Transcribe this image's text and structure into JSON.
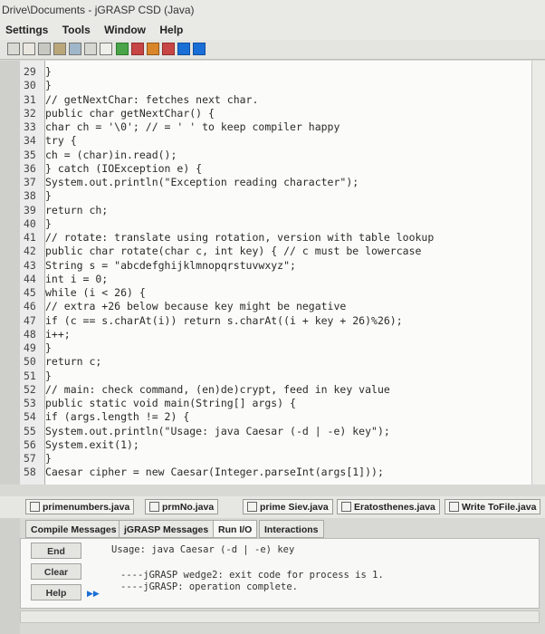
{
  "title": "Drive\\Documents - jGRASP CSD (Java)",
  "menu": [
    "Settings",
    "Tools",
    "Window",
    "Help"
  ],
  "code_lines": [
    {
      "num": "29",
      "text": "}"
    },
    {
      "num": "30",
      "text": "}"
    },
    {
      "num": "31",
      "text": "// getNextChar: fetches next char."
    },
    {
      "num": "32",
      "text": "public char getNextChar() {"
    },
    {
      "num": "33",
      "text": "char ch = '\\0'; // = ' ' to keep compiler happy"
    },
    {
      "num": "34",
      "text": "try {"
    },
    {
      "num": "35",
      "text": "ch = (char)in.read();"
    },
    {
      "num": "36",
      "text": "} catch (IOException e) {"
    },
    {
      "num": "37",
      "text": "System.out.println(\"Exception reading character\");"
    },
    {
      "num": "38",
      "text": "}"
    },
    {
      "num": "39",
      "text": "return ch;"
    },
    {
      "num": "40",
      "text": "}"
    },
    {
      "num": "41",
      "text": "// rotate: translate using rotation, version with table lookup"
    },
    {
      "num": "42",
      "text": "public char rotate(char c, int key) { // c must be lowercase"
    },
    {
      "num": "43",
      "text": "String s = \"abcdefghijklmnopqrstuvwxyz\";"
    },
    {
      "num": "44",
      "text": "int i = 0;"
    },
    {
      "num": "45",
      "text": "while (i < 26) {"
    },
    {
      "num": "46",
      "text": "// extra +26 below because key might be negative"
    },
    {
      "num": "47",
      "text": "if (c == s.charAt(i)) return s.charAt((i + key + 26)%26);"
    },
    {
      "num": "48",
      "text": "i++;"
    },
    {
      "num": "49",
      "text": "}"
    },
    {
      "num": "50",
      "text": "return c;"
    },
    {
      "num": "51",
      "text": "}"
    },
    {
      "num": "52",
      "text": "// main: check command, (en)de)crypt, feed in key value"
    },
    {
      "num": "53",
      "text": "public static void main(String[] args) {"
    },
    {
      "num": "54",
      "text": "if (args.length != 2) {"
    },
    {
      "num": "55",
      "text": "System.out.println(\"Usage: java Caesar (-d | -e) key\");"
    },
    {
      "num": "56",
      "text": "System.exit(1);"
    },
    {
      "num": "57",
      "text": "}"
    },
    {
      "num": "58",
      "text": "Caesar cipher = new Caesar(Integer.parseInt(args[1]));"
    }
  ],
  "file_tabs": [
    "primenumbers.java",
    "prmNo.java",
    "prime Siev.java",
    "Eratosthenes.java",
    "Write ToFile.java"
  ],
  "message_tabs": [
    "Compile Messages",
    "jGRASP Messages",
    "Run I/O",
    "Interactions"
  ],
  "console_buttons": [
    "End",
    "Clear",
    "Help"
  ],
  "output": {
    "usage": "Usage: java Caesar (-d | -e) key",
    "line1": "----jGRASP wedge2: exit code for process is 1.",
    "line2": "----jGRASP: operation complete."
  },
  "colors": {
    "accent": "#1a6fd6",
    "background": "#d8d8d4"
  }
}
